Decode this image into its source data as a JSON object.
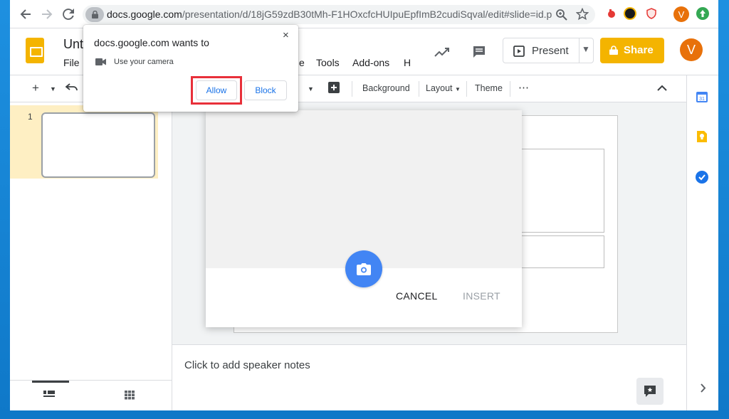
{
  "browser": {
    "url_host": "docs.google.com",
    "url_path": "/presentation/d/18jG59zdB30tMh-F1HOxcfcHUIpuEpfImB2cudiSqval/edit#slide=id.p",
    "profile_initial": "V"
  },
  "app": {
    "title_visible": "Unt",
    "menus": [
      "File",
      "e",
      "Tools",
      "Add-ons",
      "H"
    ],
    "present_label": "Present",
    "share_label": "Share",
    "avatar_initial": "V"
  },
  "toolbar": {
    "background_label": "Background",
    "layout_label": "Layout",
    "theme_label": "Theme",
    "more_label": "⋯"
  },
  "filmstrip": {
    "slide_number": "1"
  },
  "notes": {
    "placeholder": "Click to add speaker notes"
  },
  "camera_dialog": {
    "cancel_label": "CANCEL",
    "insert_label": "INSERT"
  },
  "permission_popup": {
    "title": "docs.google.com wants to",
    "request": "Use your camera",
    "allow_label": "Allow",
    "block_label": "Block",
    "close_glyph": "×"
  },
  "colors": {
    "accent_blue": "#4285f4",
    "share_yellow": "#f4b400",
    "highlight_red": "#e8303a",
    "avatar_orange": "#e8710a"
  }
}
